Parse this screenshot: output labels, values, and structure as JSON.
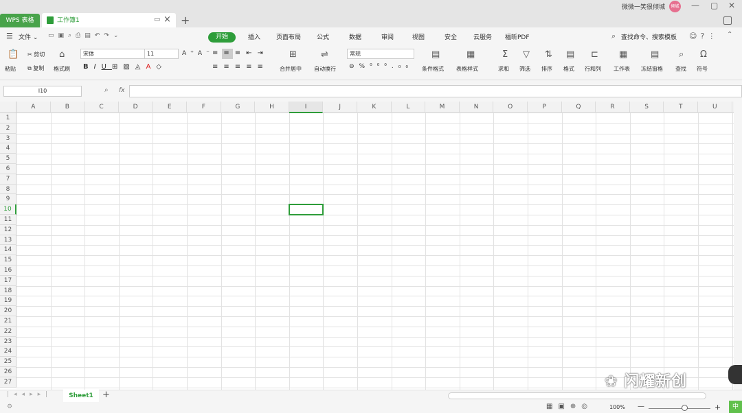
{
  "title_bar": {
    "app_tab": "WPS 表格",
    "doc_tab": "工作簿1",
    "user_name": "微微一笑很倾城",
    "avatar_text": "倾城"
  },
  "menu": [
    "开始",
    "插入",
    "页面布局",
    "公式",
    "数据",
    "审阅",
    "视图",
    "安全",
    "云服务",
    "福昕PDF"
  ],
  "search": "查找命令、搜索模板",
  "clipboard": {
    "cut": "剪切",
    "paste": "粘贴",
    "copy": "复制",
    "format_painter": "格式刷"
  },
  "font": {
    "name": "宋体",
    "size": "11"
  },
  "toolbar": {
    "merge": "合并居中",
    "wrap": "自动换行",
    "number_format": "常规",
    "cond_format": "条件格式",
    "table_style": "表格样式",
    "sum": "求和",
    "filter": "筛选",
    "sort": "排序",
    "format": "格式",
    "rows_cols": "行和列",
    "worksheet": "工作表",
    "freeze": "冻结窗格",
    "find": "查找",
    "symbol": "符号"
  },
  "name_box": "I10",
  "fx": "fx",
  "columns": [
    "A",
    "B",
    "C",
    "D",
    "E",
    "F",
    "G",
    "H",
    "I",
    "J",
    "K",
    "L",
    "M",
    "N",
    "O",
    "P",
    "Q",
    "R",
    "S",
    "T",
    "U"
  ],
  "rows": [
    "1",
    "2",
    "3",
    "4",
    "5",
    "6",
    "7",
    "8",
    "9",
    "10",
    "11",
    "12",
    "13",
    "14",
    "15",
    "16",
    "17",
    "18",
    "19",
    "20",
    "21",
    "22",
    "23",
    "24",
    "25",
    "26",
    "27"
  ],
  "selected": {
    "col": "I",
    "row": "10"
  },
  "sheet": "Sheet1",
  "zoom": "100%",
  "ime": "中",
  "watermark": "闪耀新创"
}
